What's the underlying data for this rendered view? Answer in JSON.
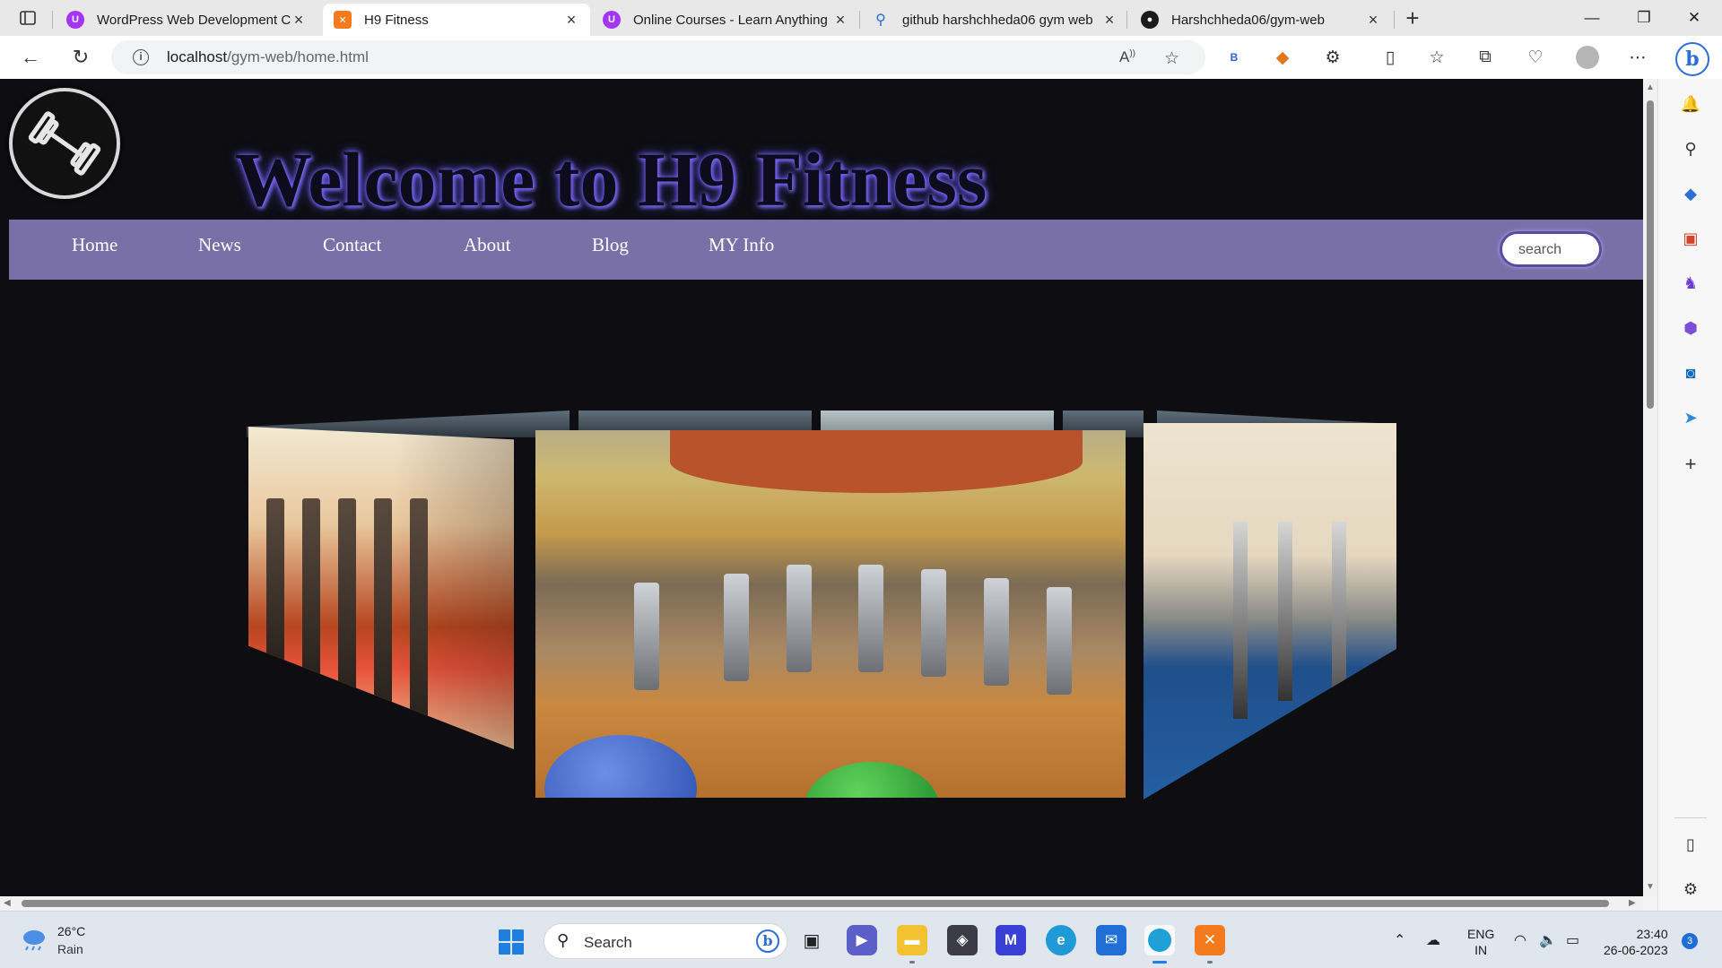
{
  "browser": {
    "tabs": [
      {
        "title": "WordPress Web Development Co",
        "favicon": "udemy-icon",
        "color": "#a435f0",
        "active": false
      },
      {
        "title": "H9 Fitness",
        "favicon": "xampp-icon",
        "color": "#f37b1d",
        "active": true
      },
      {
        "title": "Online Courses - Learn Anything",
        "favicon": "udemy-icon",
        "color": "#a435f0",
        "active": false
      },
      {
        "title": "github harshchheda06 gym web",
        "favicon": "search-icon",
        "color": "#1f6fd6",
        "active": false
      },
      {
        "title": "Harshchheda06/gym-web",
        "favicon": "github-icon",
        "color": "#1b1b1b",
        "active": false
      }
    ],
    "url_host": "localhost",
    "url_path": "/gym-web/home.html"
  },
  "page": {
    "heading": "Welcome to H9 Fitness",
    "nav": [
      "Home",
      "News",
      "Contact",
      "About",
      "Blog",
      "MY Info"
    ],
    "search_placeholder": "search",
    "colors": {
      "background": "#0d0d12",
      "navbar": "#7a70a8",
      "heading_glow": "#7a68ff"
    },
    "carousel_images": [
      "gym-photo-left",
      "gym-photo-center",
      "gym-photo-right"
    ]
  },
  "taskbar": {
    "weather_temp": "26°C",
    "weather_cond": "Rain",
    "search_label": "Search",
    "lang_top": "ENG",
    "lang_bottom": "IN",
    "time": "23:40",
    "date": "26-06-2023",
    "notification_count": "3"
  }
}
